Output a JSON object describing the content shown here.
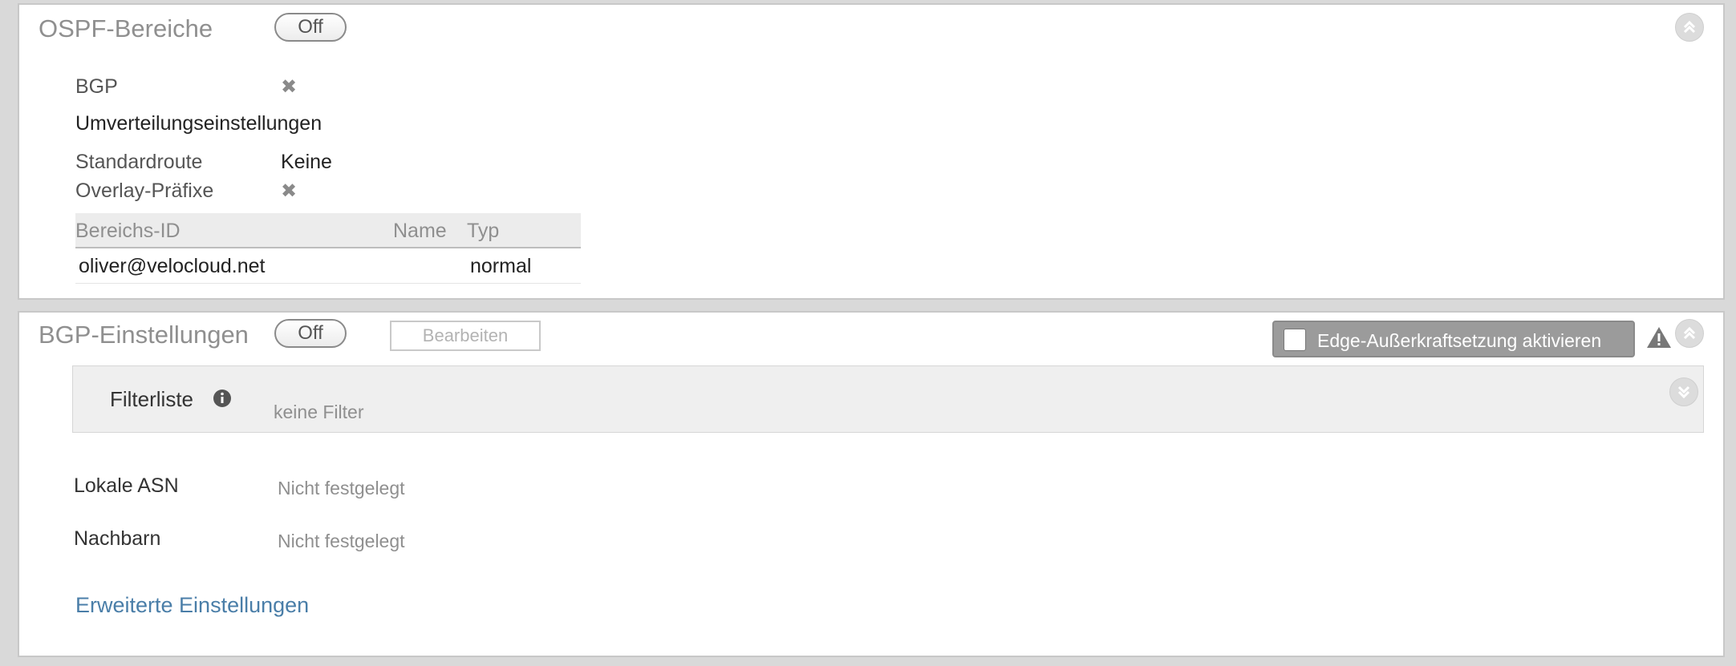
{
  "ospf": {
    "title": "OSPF-Bereiche",
    "toggle": "Off",
    "bgp_label": "BGP",
    "redistribution_heading": "Umverteilungseinstellungen",
    "default_route_label": "Standardroute",
    "default_route_value": "Keine",
    "overlay_prefixes_label": "Overlay-Präfixe",
    "x_glyph": "✖",
    "table": {
      "headers": [
        "Bereichs-ID",
        "Name",
        "Typ"
      ],
      "rows": [
        [
          "oliver@velocloud.net",
          "",
          "normal"
        ]
      ]
    }
  },
  "bgp": {
    "title": "BGP-Einstellungen",
    "toggle": "Off",
    "edit_label": "Bearbeiten",
    "override_label": "Edge-Außerkraftsetzung aktivieren",
    "filter_label": "Filterliste",
    "filter_value": "keine Filter",
    "local_asn_label": "Lokale ASN",
    "local_asn_value": "Nicht festgelegt",
    "neighbors_label": "Nachbarn",
    "neighbors_value": "Nicht festgelegt",
    "advanced_link": "Erweiterte Einstellungen"
  },
  "colors": {
    "link": "#4a7ea8",
    "override_bg": "#9b9b9b"
  }
}
